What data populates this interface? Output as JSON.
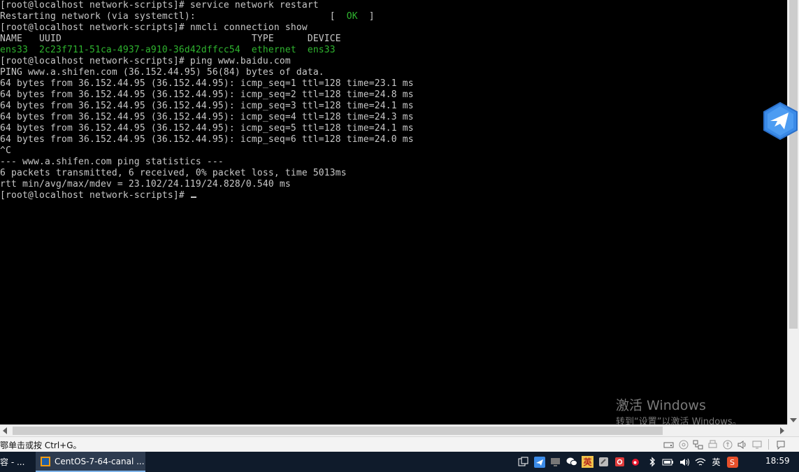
{
  "terminal": {
    "lines": [
      {
        "text": "[root@localhost network-scripts]# service network restart"
      },
      {
        "pre": "Restarting network (via systemctl):                        [  ",
        "ok": "OK",
        "post": "  ]"
      },
      {
        "text": "[root@localhost network-scripts]# nmcli connection show"
      },
      {
        "text": "NAME   UUID                                  TYPE      DEVICE"
      },
      {
        "green": "ens33  2c23f711-51ca-4937-a910-36d42dffcc54  ethernet  ens33"
      },
      {
        "text": "[root@localhost network-scripts]# ping www.baidu.com"
      },
      {
        "text": "PING www.a.shifen.com (36.152.44.95) 56(84) bytes of data."
      },
      {
        "text": "64 bytes from 36.152.44.95 (36.152.44.95): icmp_seq=1 ttl=128 time=23.1 ms"
      },
      {
        "text": "64 bytes from 36.152.44.95 (36.152.44.95): icmp_seq=2 ttl=128 time=24.8 ms"
      },
      {
        "text": "64 bytes from 36.152.44.95 (36.152.44.95): icmp_seq=3 ttl=128 time=24.1 ms"
      },
      {
        "text": "64 bytes from 36.152.44.95 (36.152.44.95): icmp_seq=4 ttl=128 time=24.3 ms"
      },
      {
        "text": "64 bytes from 36.152.44.95 (36.152.44.95): icmp_seq=5 ttl=128 time=24.1 ms"
      },
      {
        "text": "64 bytes from 36.152.44.95 (36.152.44.95): icmp_seq=6 ttl=128 time=24.0 ms"
      },
      {
        "text": "^C"
      },
      {
        "text": "--- www.a.shifen.com ping statistics ---"
      },
      {
        "text": "6 packets transmitted, 6 received, 0% packet loss, time 5013ms"
      },
      {
        "text": "rtt min/avg/max/mdev = 23.102/24.119/24.828/0.540 ms"
      },
      {
        "text": "[root@localhost network-scripts]# ",
        "cursor": true
      }
    ],
    "colors": {
      "foreground": "#c8c8c8",
      "green": "#2fb52f",
      "background": "#000000"
    }
  },
  "watermark": {
    "title": "激活 Windows",
    "subtitle": "转到“设置”以激活 Windows。"
  },
  "statusbar": {
    "hint": "鄂单击或按 Ctrl+G。"
  },
  "taskbar": {
    "prev_item": "容 - ...",
    "active_item": "CentOS-7-64-canal ...",
    "ime_label": "英",
    "ime_input": "英",
    "clock": "18:59"
  },
  "icons": {
    "float_widget": "bird-icon",
    "vm_app": "vmware-icon"
  }
}
